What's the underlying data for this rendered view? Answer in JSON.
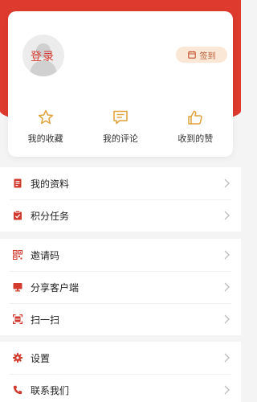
{
  "profile": {
    "login_label": "登录",
    "checkin_label": "签到"
  },
  "quick_actions": [
    {
      "label": "我的收藏",
      "icon": "star-icon"
    },
    {
      "label": "我的评论",
      "icon": "comment-icon"
    },
    {
      "label": "收到的赞",
      "icon": "thumbs-up-icon"
    }
  ],
  "menu_groups": [
    [
      {
        "label": "我的资料",
        "icon": "profile-document-icon"
      },
      {
        "label": "积分任务",
        "icon": "clipboard-check-icon"
      }
    ],
    [
      {
        "label": "邀请码",
        "icon": "qr-code-icon"
      },
      {
        "label": "分享客户端",
        "icon": "monitor-icon"
      },
      {
        "label": "扫一扫",
        "icon": "scan-icon"
      }
    ],
    [
      {
        "label": "设置",
        "icon": "gear-icon"
      },
      {
        "label": "联系我们",
        "icon": "phone-icon"
      }
    ]
  ],
  "colors": {
    "brand_red": "#de3a2e",
    "checkin_bg": "#fbe7d6",
    "quick_icon": "#e0a23a"
  }
}
